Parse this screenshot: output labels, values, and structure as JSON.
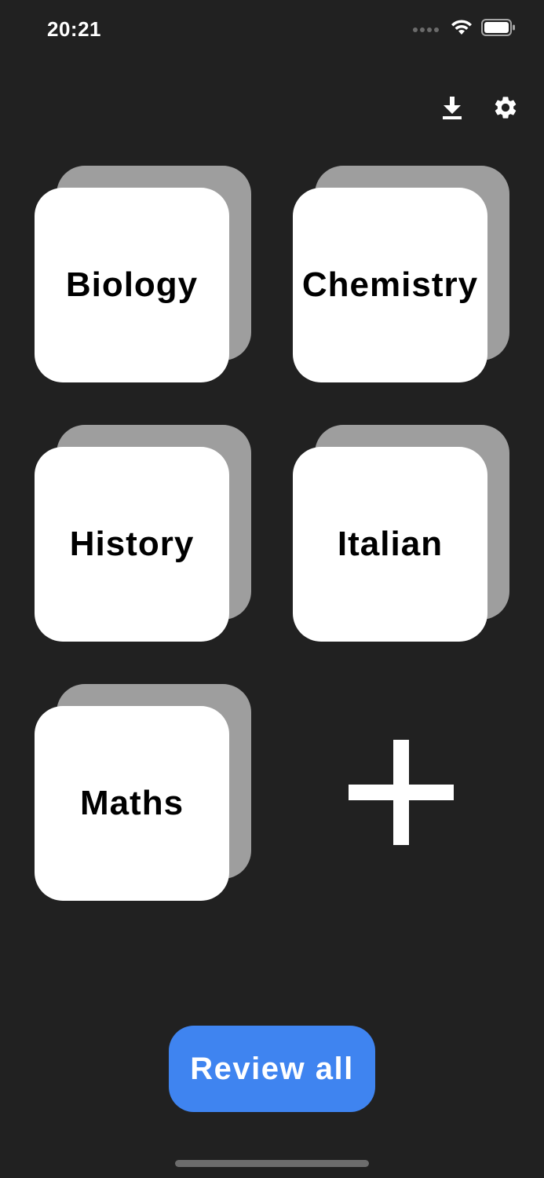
{
  "status_bar": {
    "time": "20:21"
  },
  "toolbar": {
    "download_icon": "download-icon",
    "settings_icon": "gear-icon"
  },
  "decks": [
    {
      "label": "Biology"
    },
    {
      "label": "Chemistry"
    },
    {
      "label": "History"
    },
    {
      "label": "Italian"
    },
    {
      "label": "Maths"
    }
  ],
  "add_deck": {
    "icon": "plus-icon"
  },
  "review_button": {
    "label": "Review all"
  },
  "colors": {
    "background": "#212121",
    "card_front": "#ffffff",
    "card_back": "#9e9e9e",
    "accent": "#3f84f0"
  }
}
